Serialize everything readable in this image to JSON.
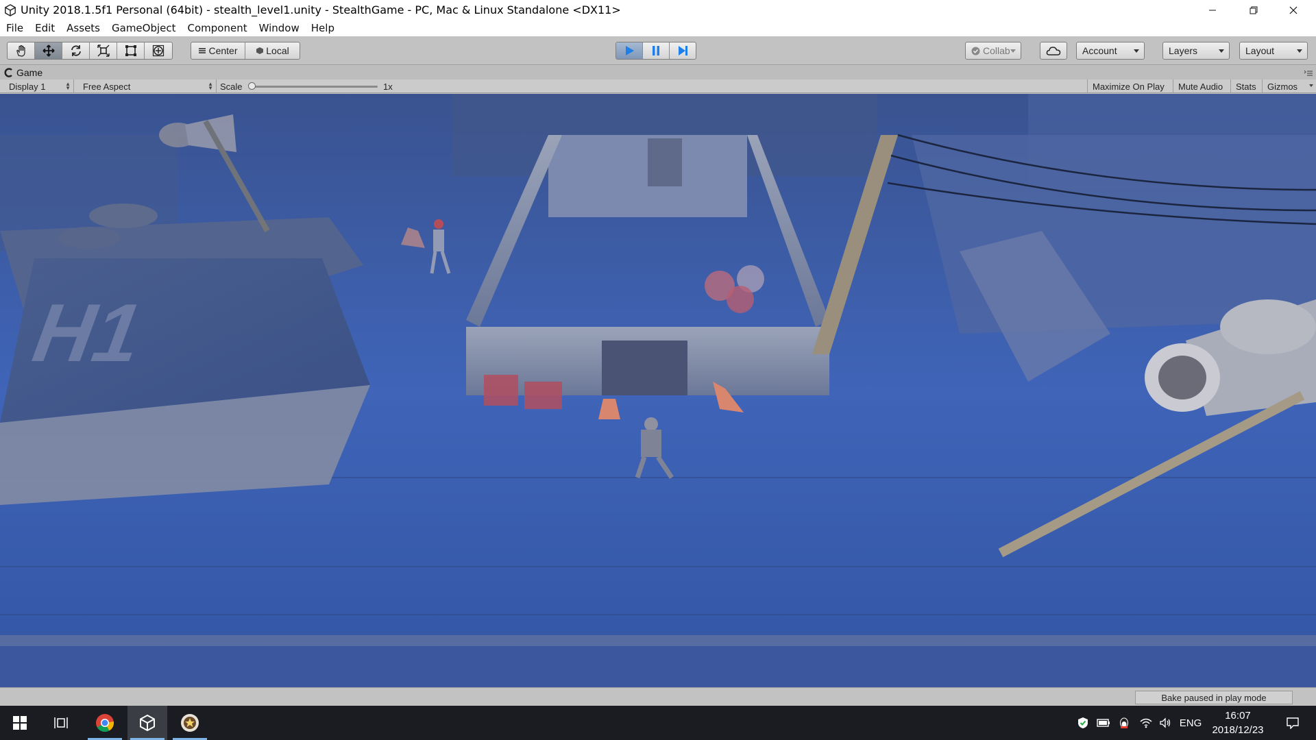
{
  "window": {
    "title": "Unity 2018.1.5f1 Personal (64bit) - stealth_level1.unity - StealthGame - PC, Mac & Linux Standalone <DX11>",
    "controls": [
      "minimize-icon",
      "restore-icon",
      "close-icon"
    ]
  },
  "menu": {
    "items": [
      "File",
      "Edit",
      "Assets",
      "GameObject",
      "Component",
      "Window",
      "Help"
    ]
  },
  "toolbar": {
    "tools": [
      "hand-tool-icon",
      "move-tool-icon",
      "rotate-tool-icon",
      "scale-tool-icon",
      "rect-tool-icon",
      "transform-tool-icon"
    ],
    "active_tool": "move-tool-icon",
    "pivot_label": "Center",
    "space_label": "Local",
    "play_state": "playing",
    "collab_label": "Collab",
    "account_label": "Account",
    "layers_label": "Layers",
    "layout_label": "Layout",
    "accent_color": "#3d8ee6"
  },
  "game_view": {
    "tab_label": "Game",
    "display_label": "Display 1",
    "aspect_label": "Free Aspect",
    "scale_label": "Scale",
    "scale_value": "1x",
    "scale_fraction": 0.0,
    "maximize_label": "Maximize On Play",
    "mute_label": "Mute Audio",
    "stats_label": "Stats",
    "gizmos_label": "Gizmos"
  },
  "status": {
    "bake_message": "Bake paused in play mode"
  },
  "taskbar": {
    "apps": [
      "start-icon",
      "task-view-icon",
      "chrome-icon",
      "unity-icon",
      "game-app-icon"
    ],
    "running": [
      "chrome-icon",
      "unity-icon",
      "game-app-icon"
    ],
    "language": "ENG",
    "time": "16:07",
    "date": "2018/12/23"
  },
  "scene": {
    "description_colors": {
      "fog": "#3d5ea8",
      "ground": "#2c4a8e",
      "walls": "#8b93a8"
    }
  }
}
